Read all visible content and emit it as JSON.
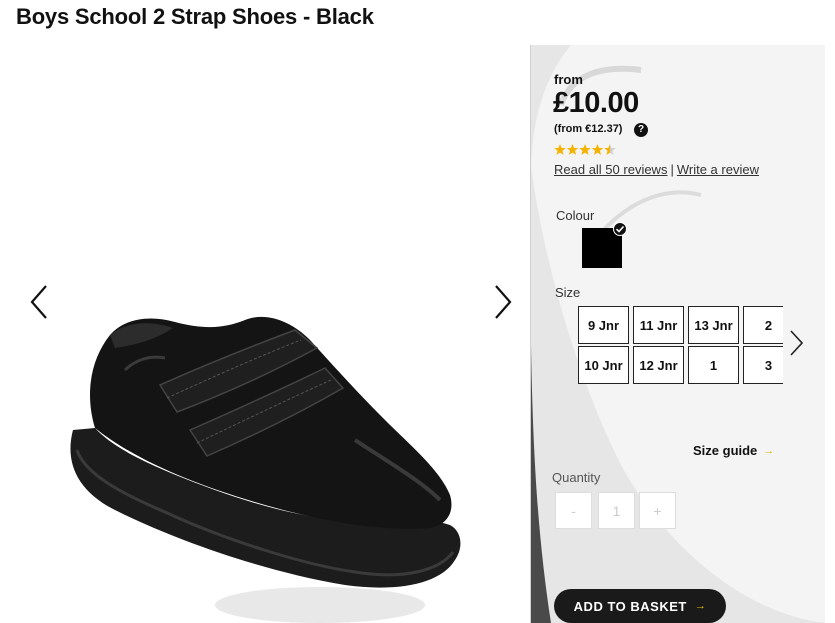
{
  "product": {
    "title": "Boys School 2 Strap Shoes - Black"
  },
  "pricing": {
    "from_label": "from",
    "price": "£10.00",
    "euro_price": "(from €12.37)",
    "help_icon_glyph": "?"
  },
  "rating": {
    "stars": 4.5,
    "max_stars": 5,
    "star_color": "#f5b301",
    "read_reviews": "Read all 50 reviews",
    "separator": "|",
    "write_review": "Write a review"
  },
  "colour": {
    "label": "Colour",
    "selected": "Black",
    "swatch_color": "#000000"
  },
  "size": {
    "label": "Size",
    "options_row1": [
      "9 Jnr",
      "11 Jnr",
      "13 Jnr",
      "2"
    ],
    "options_row2": [
      "10 Jnr",
      "12 Jnr",
      "1",
      "3"
    ],
    "guide_label": "Size guide",
    "guide_arrow": "→"
  },
  "quantity": {
    "label": "Quantity",
    "minus": "-",
    "value": "1",
    "plus": "+"
  },
  "basket": {
    "label": "ADD TO BASKET",
    "arrow": "→"
  },
  "icons": {
    "gallery_prev": "chevron-left-icon",
    "gallery_next": "chevron-right-icon",
    "size_next": "chevron-right-icon",
    "swatch_selected": "checkmark-icon"
  }
}
